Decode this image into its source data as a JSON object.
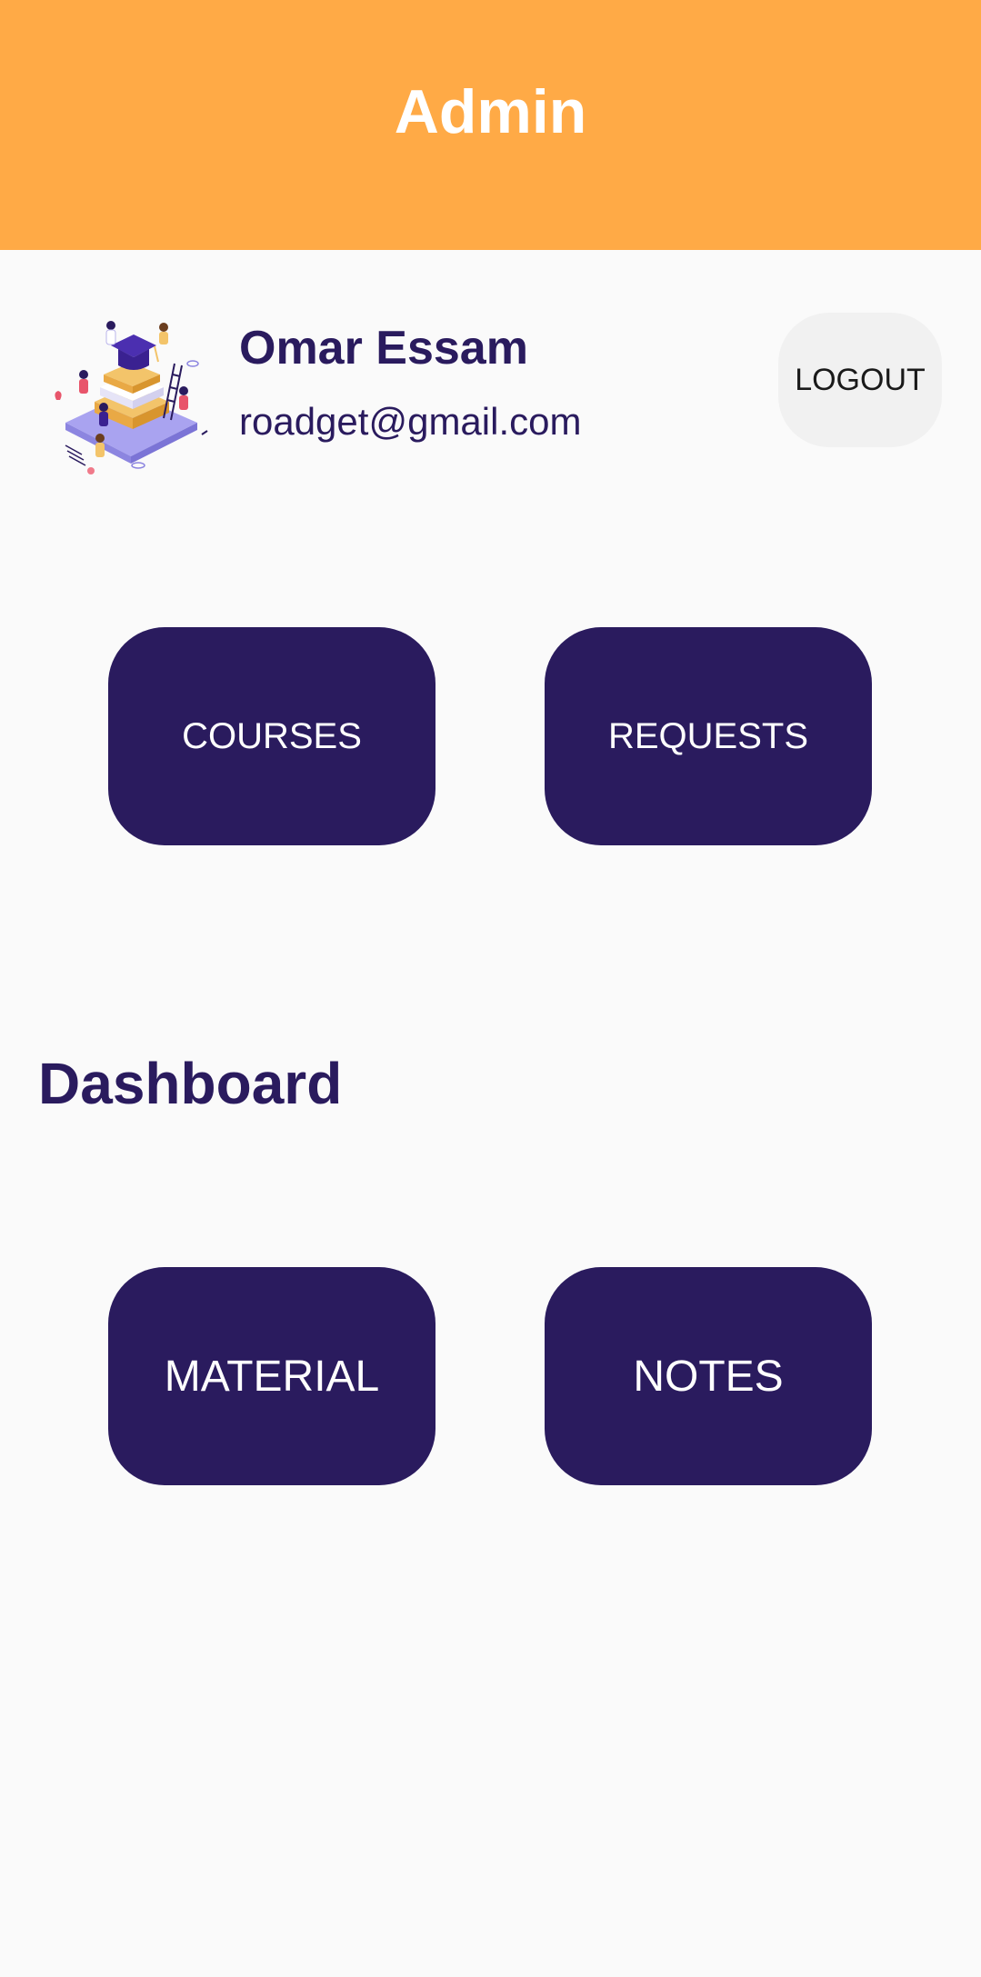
{
  "app_bar": {
    "title": "Admin",
    "color": "#FFAA46"
  },
  "profile": {
    "avatar_icon": "education-illustration-icon",
    "name": "Omar Essam",
    "email": "roadget@gmail.com",
    "logout_label": "LOGOUT"
  },
  "top_actions": {
    "courses_label": "COURSES",
    "requests_label": "REQUESTS"
  },
  "dashboard": {
    "title": "Dashboard",
    "material_label": "MATERIAL",
    "notes_label": "NOTES"
  },
  "colors": {
    "primary": "#2A1B5E",
    "accent": "#FFAA46",
    "background": "#FAFAFA",
    "logout_bg": "#F1F1F1"
  }
}
